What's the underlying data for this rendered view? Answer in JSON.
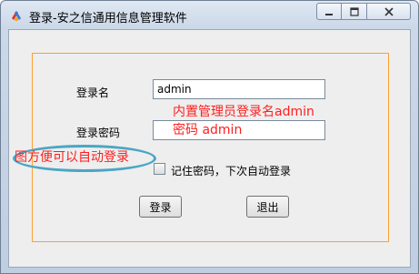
{
  "window": {
    "title": "登录-安之信通用信息管理软件"
  },
  "form": {
    "username_label": "登录名",
    "username_value": "admin",
    "password_label": "登录密码",
    "remember_label": "记住密码，下次自动登录",
    "login_button": "登录",
    "exit_button": "退出"
  },
  "annotations": {
    "builtin_admin": "内置管理员登录名admin",
    "password_hint": "密码 admin",
    "auto_login_tip": "图方便可以自动登录"
  },
  "colors": {
    "annotation_text": "#ff1e1e",
    "panel_border": "#ffa030",
    "bubble_outline": "#4aa6c4"
  }
}
